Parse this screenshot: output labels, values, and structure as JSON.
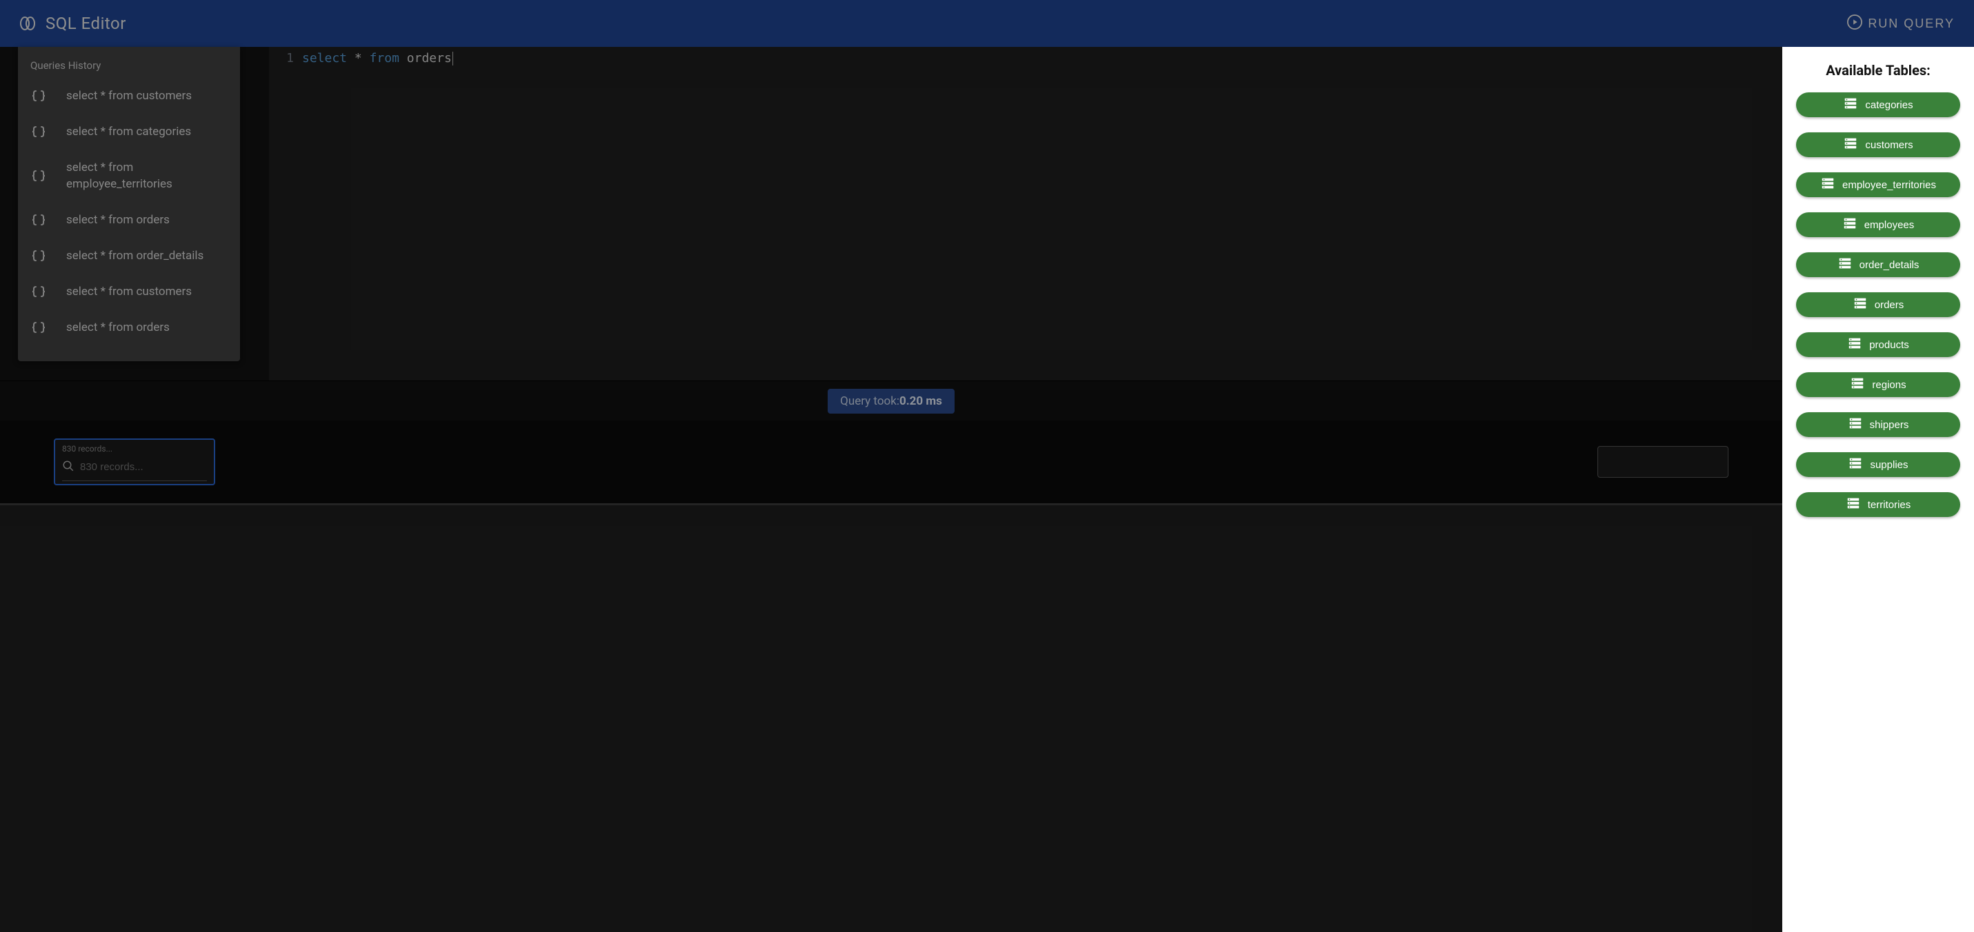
{
  "header": {
    "app_title": "SQL Editor",
    "run_label": "RUN QUERY"
  },
  "history": {
    "title": "Queries History",
    "items": [
      {
        "query": "select * from customers"
      },
      {
        "query": "select * from categories"
      },
      {
        "query": "select * from employee_territories"
      },
      {
        "query": "select * from orders"
      },
      {
        "query": "select * from order_details"
      },
      {
        "query": "select * from customers"
      },
      {
        "query": "select * from orders"
      }
    ]
  },
  "editor": {
    "line_number": "1",
    "tokens": {
      "kw1": "select",
      "star": "*",
      "kw2": "from",
      "ident": "orders"
    }
  },
  "status": {
    "prefix": "Query took:",
    "value": "0.20 ms"
  },
  "search": {
    "placeholder": "830 records..."
  },
  "drawer": {
    "title": "Available Tables:",
    "tables": [
      "categories",
      "customers",
      "employee_territories",
      "employees",
      "order_details",
      "orders",
      "products",
      "regions",
      "shippers",
      "supplies",
      "territories"
    ]
  },
  "colors": {
    "header_bg": "#1f4494",
    "drawer_chip": "#3a823a",
    "status_chip": "#2a4a8a",
    "focus_border": "#2b66d1"
  }
}
